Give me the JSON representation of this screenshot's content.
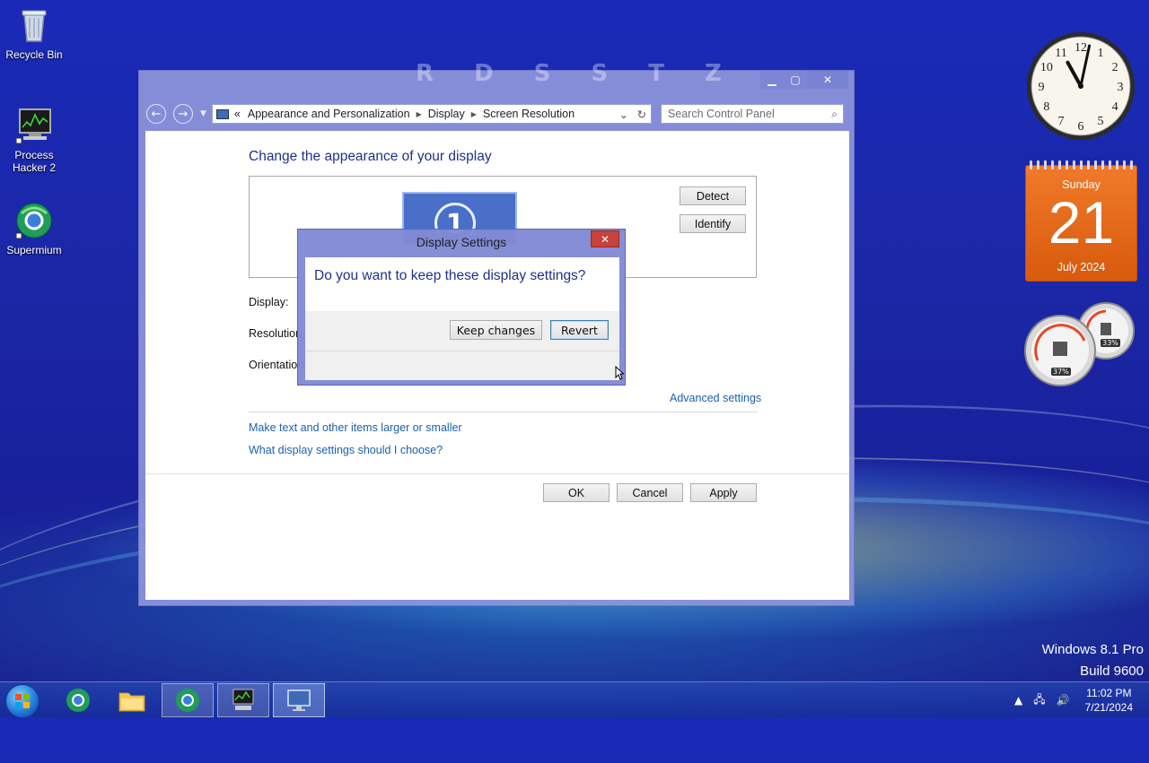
{
  "desktop": {
    "icons": [
      {
        "label": "Recycle Bin",
        "icon": "recycle-bin-icon"
      },
      {
        "label": "Process Hacker 2",
        "label_line1": "Process",
        "label_line2": "Hacker 2",
        "icon": "process-hacker-icon"
      },
      {
        "label": "Supermium",
        "icon": "supermium-icon"
      }
    ],
    "watermark": {
      "line1": "Windows 8.1 Pro",
      "line2": "Build 9600"
    }
  },
  "window": {
    "ghost_title": "R D S S     T Z",
    "controls": {
      "minimize": "▁",
      "maximize": "▢",
      "close": "✕"
    },
    "navbar": {
      "back": "←",
      "forward": "→",
      "breadcrumb_prefix": "«",
      "breadcrumbs": [
        "Appearance and Personalization",
        "Display",
        "Screen Resolution"
      ],
      "search_placeholder": "Search Control Panel"
    },
    "title": "Change the appearance of your display",
    "monitor_number": "1",
    "detect_label": "Detect",
    "identify_label": "Identify",
    "labels": {
      "display": "Display:",
      "resolution": "Resolution",
      "orientation": "Orientation"
    },
    "advanced_settings": "Advanced settings",
    "links": [
      "Make text and other items larger or smaller",
      "What display settings should I choose?"
    ],
    "footer": {
      "ok": "OK",
      "cancel": "Cancel",
      "apply": "Apply"
    }
  },
  "dialog": {
    "title": "Display Settings",
    "question": "Do you want to keep these display settings?",
    "keep_label": "Keep changes",
    "revert_label": "Revert",
    "close": "✕"
  },
  "gadgets": {
    "clock": {
      "hour": 11,
      "minute": 2
    },
    "calendar": {
      "weekday": "Sunday",
      "day": "21",
      "month_year": "July 2024"
    },
    "cpu_meter": {
      "cpu_label": "37%",
      "memory_label": "33%"
    }
  },
  "taskbar": {
    "tray_time": "11:02 PM",
    "tray_date": "7/21/2024"
  },
  "colors": {
    "accent_blue": "#1e3287",
    "link_blue": "#1a60b0",
    "calendar_orange": "#e86b1c",
    "desktop_blue": "#1b27a6"
  }
}
